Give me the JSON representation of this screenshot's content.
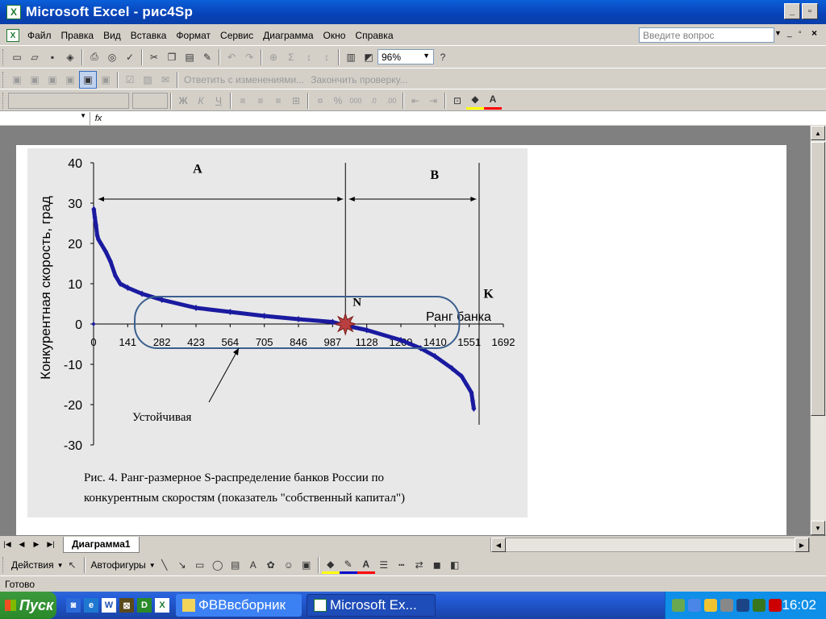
{
  "window": {
    "title": "Microsoft Excel - рис4Sp"
  },
  "menu": {
    "items": [
      "Файл",
      "Правка",
      "Вид",
      "Вставка",
      "Формат",
      "Сервис",
      "Диаграмма",
      "Окно",
      "Справка"
    ],
    "ask_placeholder": "Введите вопрос"
  },
  "toolbar": {
    "zoom": "96%",
    "review_reply": "Ответить с изменениями...",
    "review_end": "Закончить проверку..."
  },
  "formula": {
    "fx": "fx"
  },
  "chart_data": {
    "type": "scatter",
    "series": [
      {
        "name": "",
        "color": "#1a1aa0"
      }
    ],
    "x_ticks": [
      0,
      141,
      282,
      423,
      564,
      705,
      846,
      987,
      1128,
      1269,
      1410,
      1551,
      1692
    ],
    "y_ticks": [
      40,
      30,
      20,
      10,
      0,
      -10,
      -20,
      -30
    ],
    "xlim": [
      0,
      1692
    ],
    "ylim": [
      -30,
      40
    ],
    "ylabel": "Конкурентная скорость, град",
    "xlabel": "Ранг банка",
    "points": [
      [
        1,
        28.5
      ],
      [
        5,
        26.5
      ],
      [
        10,
        24.5
      ],
      [
        15,
        22
      ],
      [
        20,
        21
      ],
      [
        30,
        20
      ],
      [
        50,
        18
      ],
      [
        70,
        15.5
      ],
      [
        90,
        12
      ],
      [
        110,
        10
      ],
      [
        141,
        9
      ],
      [
        200,
        7.5
      ],
      [
        282,
        6
      ],
      [
        423,
        4
      ],
      [
        564,
        3
      ],
      [
        705,
        2
      ],
      [
        846,
        1.2
      ],
      [
        987,
        0.5
      ],
      [
        1050,
        -0.5
      ],
      [
        1128,
        -1.5
      ],
      [
        1269,
        -4
      ],
      [
        1350,
        -6
      ],
      [
        1410,
        -8
      ],
      [
        1480,
        -11
      ],
      [
        1520,
        -13
      ],
      [
        1540,
        -15
      ],
      [
        1560,
        -17
      ],
      [
        1565,
        -19
      ],
      [
        1570,
        -21
      ]
    ],
    "annotations": {
      "region_a": "A",
      "region_b": "B",
      "point_n": "N",
      "point_k": "K",
      "stable": "Устойчивая"
    },
    "caption_line1": "Рис. 4. Ранг-размерное S-распределение банков России по",
    "caption_line2": "конкурентным скоростям (показатель \"собственный капитал\")",
    "grid": false,
    "legend": "none"
  },
  "sheet_tab": "Диаграмма1",
  "drawing": {
    "actions": "Действия",
    "autoshapes": "Автофигуры"
  },
  "status": {
    "text": "Готово"
  },
  "taskbar": {
    "start": "Пуск",
    "tasks": [
      "ФВВвсборник",
      "Microsoft Ex..."
    ],
    "clock": "16:02"
  },
  "colors": {
    "accent": "#0a5fd8",
    "series": "#1a1aa0",
    "star": "#b84040"
  }
}
